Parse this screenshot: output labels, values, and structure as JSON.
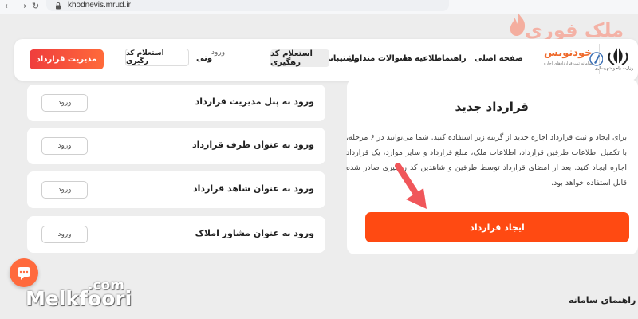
{
  "browser": {
    "url": "khodnevis.mrud.ir"
  },
  "header": {
    "logo_caption": "وزارت راه و شهرسازی",
    "brand_name": "خودنویس",
    "brand_sub": "سامانه ثبت قراردادهای اجاره",
    "menu": {
      "home": "صفحه اصلی",
      "guide": "راهنما",
      "news": "اطلاعیه ها",
      "faq": "سوالات متداول",
      "support": "پشتیبانی",
      "tracking": "استعلام کد رهگیری"
    },
    "login_small": "ورود",
    "vati": "وتی",
    "tracking_button": "استعلام کد رگیری",
    "cta_label": "مدیریت قرارداد"
  },
  "list": [
    {
      "label": "ورود به پنل مدیریت قرارداد",
      "button": "ورود"
    },
    {
      "label": "ورود به عنوان طرف قرارداد",
      "button": "ورود"
    },
    {
      "label": "ورود به عنوان شاهد قرارداد",
      "button": "ورود"
    },
    {
      "label": "ورود به عنوان مشاور املاک",
      "button": "ورود"
    }
  ],
  "card": {
    "title": "قرارداد جدید",
    "paragraph": "برای ایجاد و ثبت قرارداد اجاره جدید از گزینه زیر استفاده کنید. شما می‌توانید در ۶ مرحله، با تکمیل اطلاعات طرفین قرارداد، اطلاعات ملک، مبلغ قرارداد و سایر موارد، یک قرارداد اجاره ایجاد کنید. بعد از امضای قرارداد توسط طرفین و شاهدین کد رهگیری صادر شده قابل استفاده خواهد بود.",
    "button": "ایجاد قرارداد"
  },
  "help_title": "راهنمای سامانه",
  "watermark": {
    "top": "ملک فوری",
    "bottom": "Melkfoori",
    "bottom_com": ".com"
  },
  "colors": {
    "accent": "#ff4a12",
    "cta_start": "#ef3d3d",
    "cta_end": "#ff6a3a",
    "arrow": "#f0565a",
    "chat": "#ff6a3d"
  }
}
